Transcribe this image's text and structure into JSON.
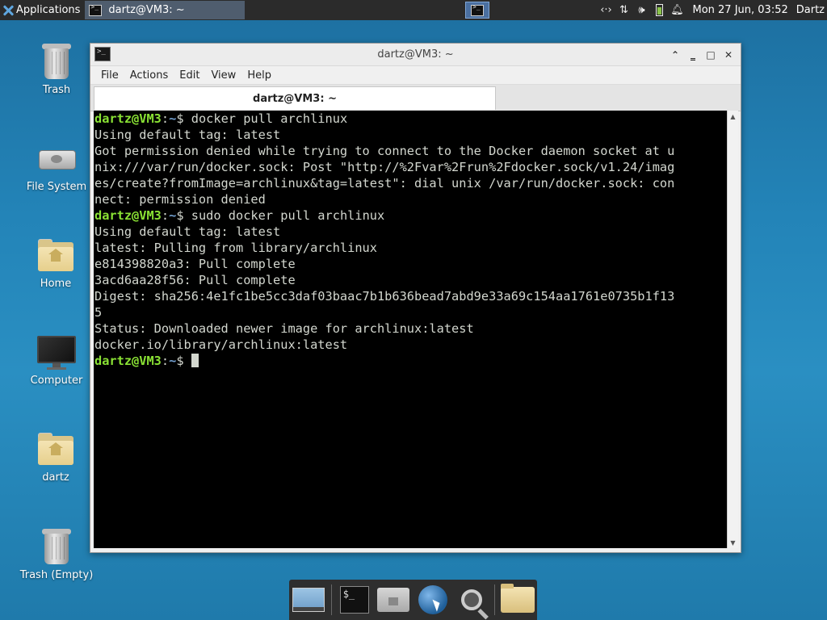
{
  "top_panel": {
    "applications_label": "Applications",
    "task_title": "dartz@VM3: ~",
    "clock": "Mon 27 Jun, 03:52",
    "user": "Dartz",
    "tray_icons": [
      "network-arrows-icon",
      "updown-arrows-icon",
      "volume-icon",
      "battery-icon",
      "bell-icon"
    ]
  },
  "desktop": {
    "icons": [
      {
        "label": "Trash",
        "icon": "trash-icon"
      },
      {
        "label": "File System",
        "icon": "drive-icon"
      },
      {
        "label": "Home",
        "icon": "home-folder-icon"
      },
      {
        "label": "Computer",
        "icon": "monitor-icon"
      },
      {
        "label": "dartz",
        "icon": "home-folder-icon"
      },
      {
        "label": "Trash (Empty)",
        "icon": "trash-icon"
      }
    ]
  },
  "window": {
    "title": "dartz@VM3: ~",
    "menu": [
      "File",
      "Actions",
      "Edit",
      "View",
      "Help"
    ],
    "tab_label": "dartz@VM3: ~"
  },
  "terminal": {
    "prompt_user": "dartz@VM3",
    "prompt_sep": ":",
    "prompt_path": "~",
    "prompt_dollar": "$ ",
    "cmd1": "docker pull archlinux",
    "cmd2": "sudo docker pull archlinux",
    "out1": [
      "Using default tag: latest",
      "Got permission denied while trying to connect to the Docker daemon socket at u",
      "nix:///var/run/docker.sock: Post \"http://%2Fvar%2Frun%2Fdocker.sock/v1.24/imag",
      "es/create?fromImage=archlinux&tag=latest\": dial unix /var/run/docker.sock: con",
      "nect: permission denied"
    ],
    "out2": [
      "Using default tag: latest",
      "latest: Pulling from library/archlinux",
      "e814398820a3: Pull complete",
      "3acd6aa28f56: Pull complete",
      "Digest: sha256:4e1fc1be5cc3daf03baac7b1b636bead7abd9e33a69c154aa1761e0735b1f13",
      "5",
      "Status: Downloaded newer image for archlinux:latest",
      "docker.io/library/archlinux:latest"
    ]
  },
  "dock": {
    "items": [
      "show-desktop-icon",
      "terminal-icon",
      "file-manager-icon",
      "web-browser-icon",
      "app-finder-icon",
      "folder-icon"
    ]
  }
}
